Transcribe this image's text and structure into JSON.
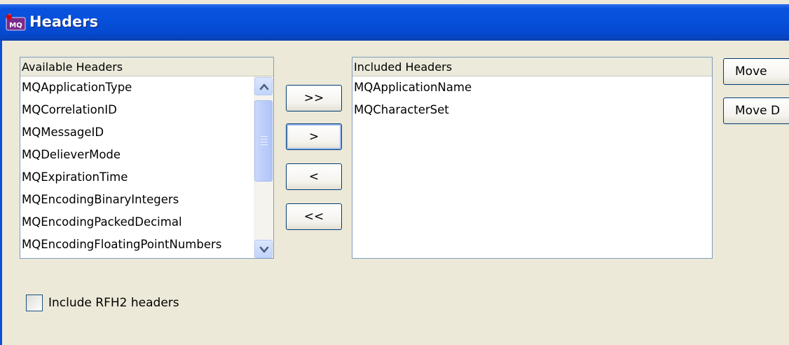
{
  "window": {
    "title": "Headers",
    "icon_text": "MQ",
    "icon": "mq-app-icon"
  },
  "available": {
    "header": "Available Headers",
    "items": [
      "MQApplicationType",
      "MQCorrelationID",
      "MQMessageID",
      "MQDelieverMode",
      "MQExpirationTime",
      "MQEncodingBinaryIntegers",
      "MQEncodingPackedDecimal",
      "MQEncodingFloatingPointNumbers"
    ],
    "scrollbar": {
      "up_icon": "chevron-up-icon",
      "down_icon": "chevron-down-icon"
    }
  },
  "transfer": {
    "add_all": ">>",
    "add": ">",
    "remove": "<",
    "remove_all": "<<"
  },
  "included": {
    "header": "Included Headers",
    "items": [
      "MQApplicationName",
      "MQCharacterSet"
    ]
  },
  "order": {
    "move_up": "Move",
    "move_down": "Move D"
  },
  "rfh2": {
    "label": "Include RFH2 headers",
    "checked": false
  },
  "colors": {
    "titlebar": "#0651dc",
    "panel_border": "#7f9db9",
    "dialog_bg": "#ece9d8",
    "button_border": "#003c74"
  }
}
